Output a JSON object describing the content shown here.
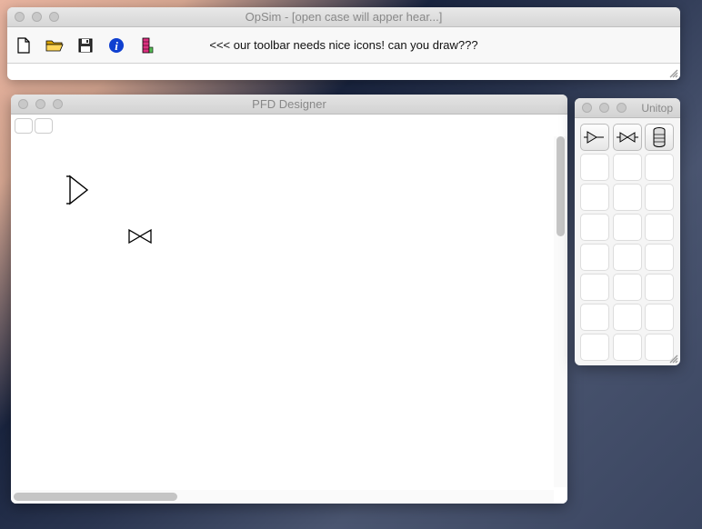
{
  "main_window": {
    "title": "OpSim - [open case will apper hear...]",
    "toolbar_message": "<<< our toolbar needs nice icons! can you draw???",
    "icons": [
      "new-file",
      "open-file",
      "save-file",
      "info",
      "column"
    ]
  },
  "pfd_window": {
    "title": "PFD Designer",
    "canvas_items": [
      "pump-symbol",
      "valve-symbol"
    ]
  },
  "unitop_window": {
    "title": "Unitop",
    "palette_items": [
      "pump-icon",
      "valve-icon",
      "column-icon"
    ]
  }
}
